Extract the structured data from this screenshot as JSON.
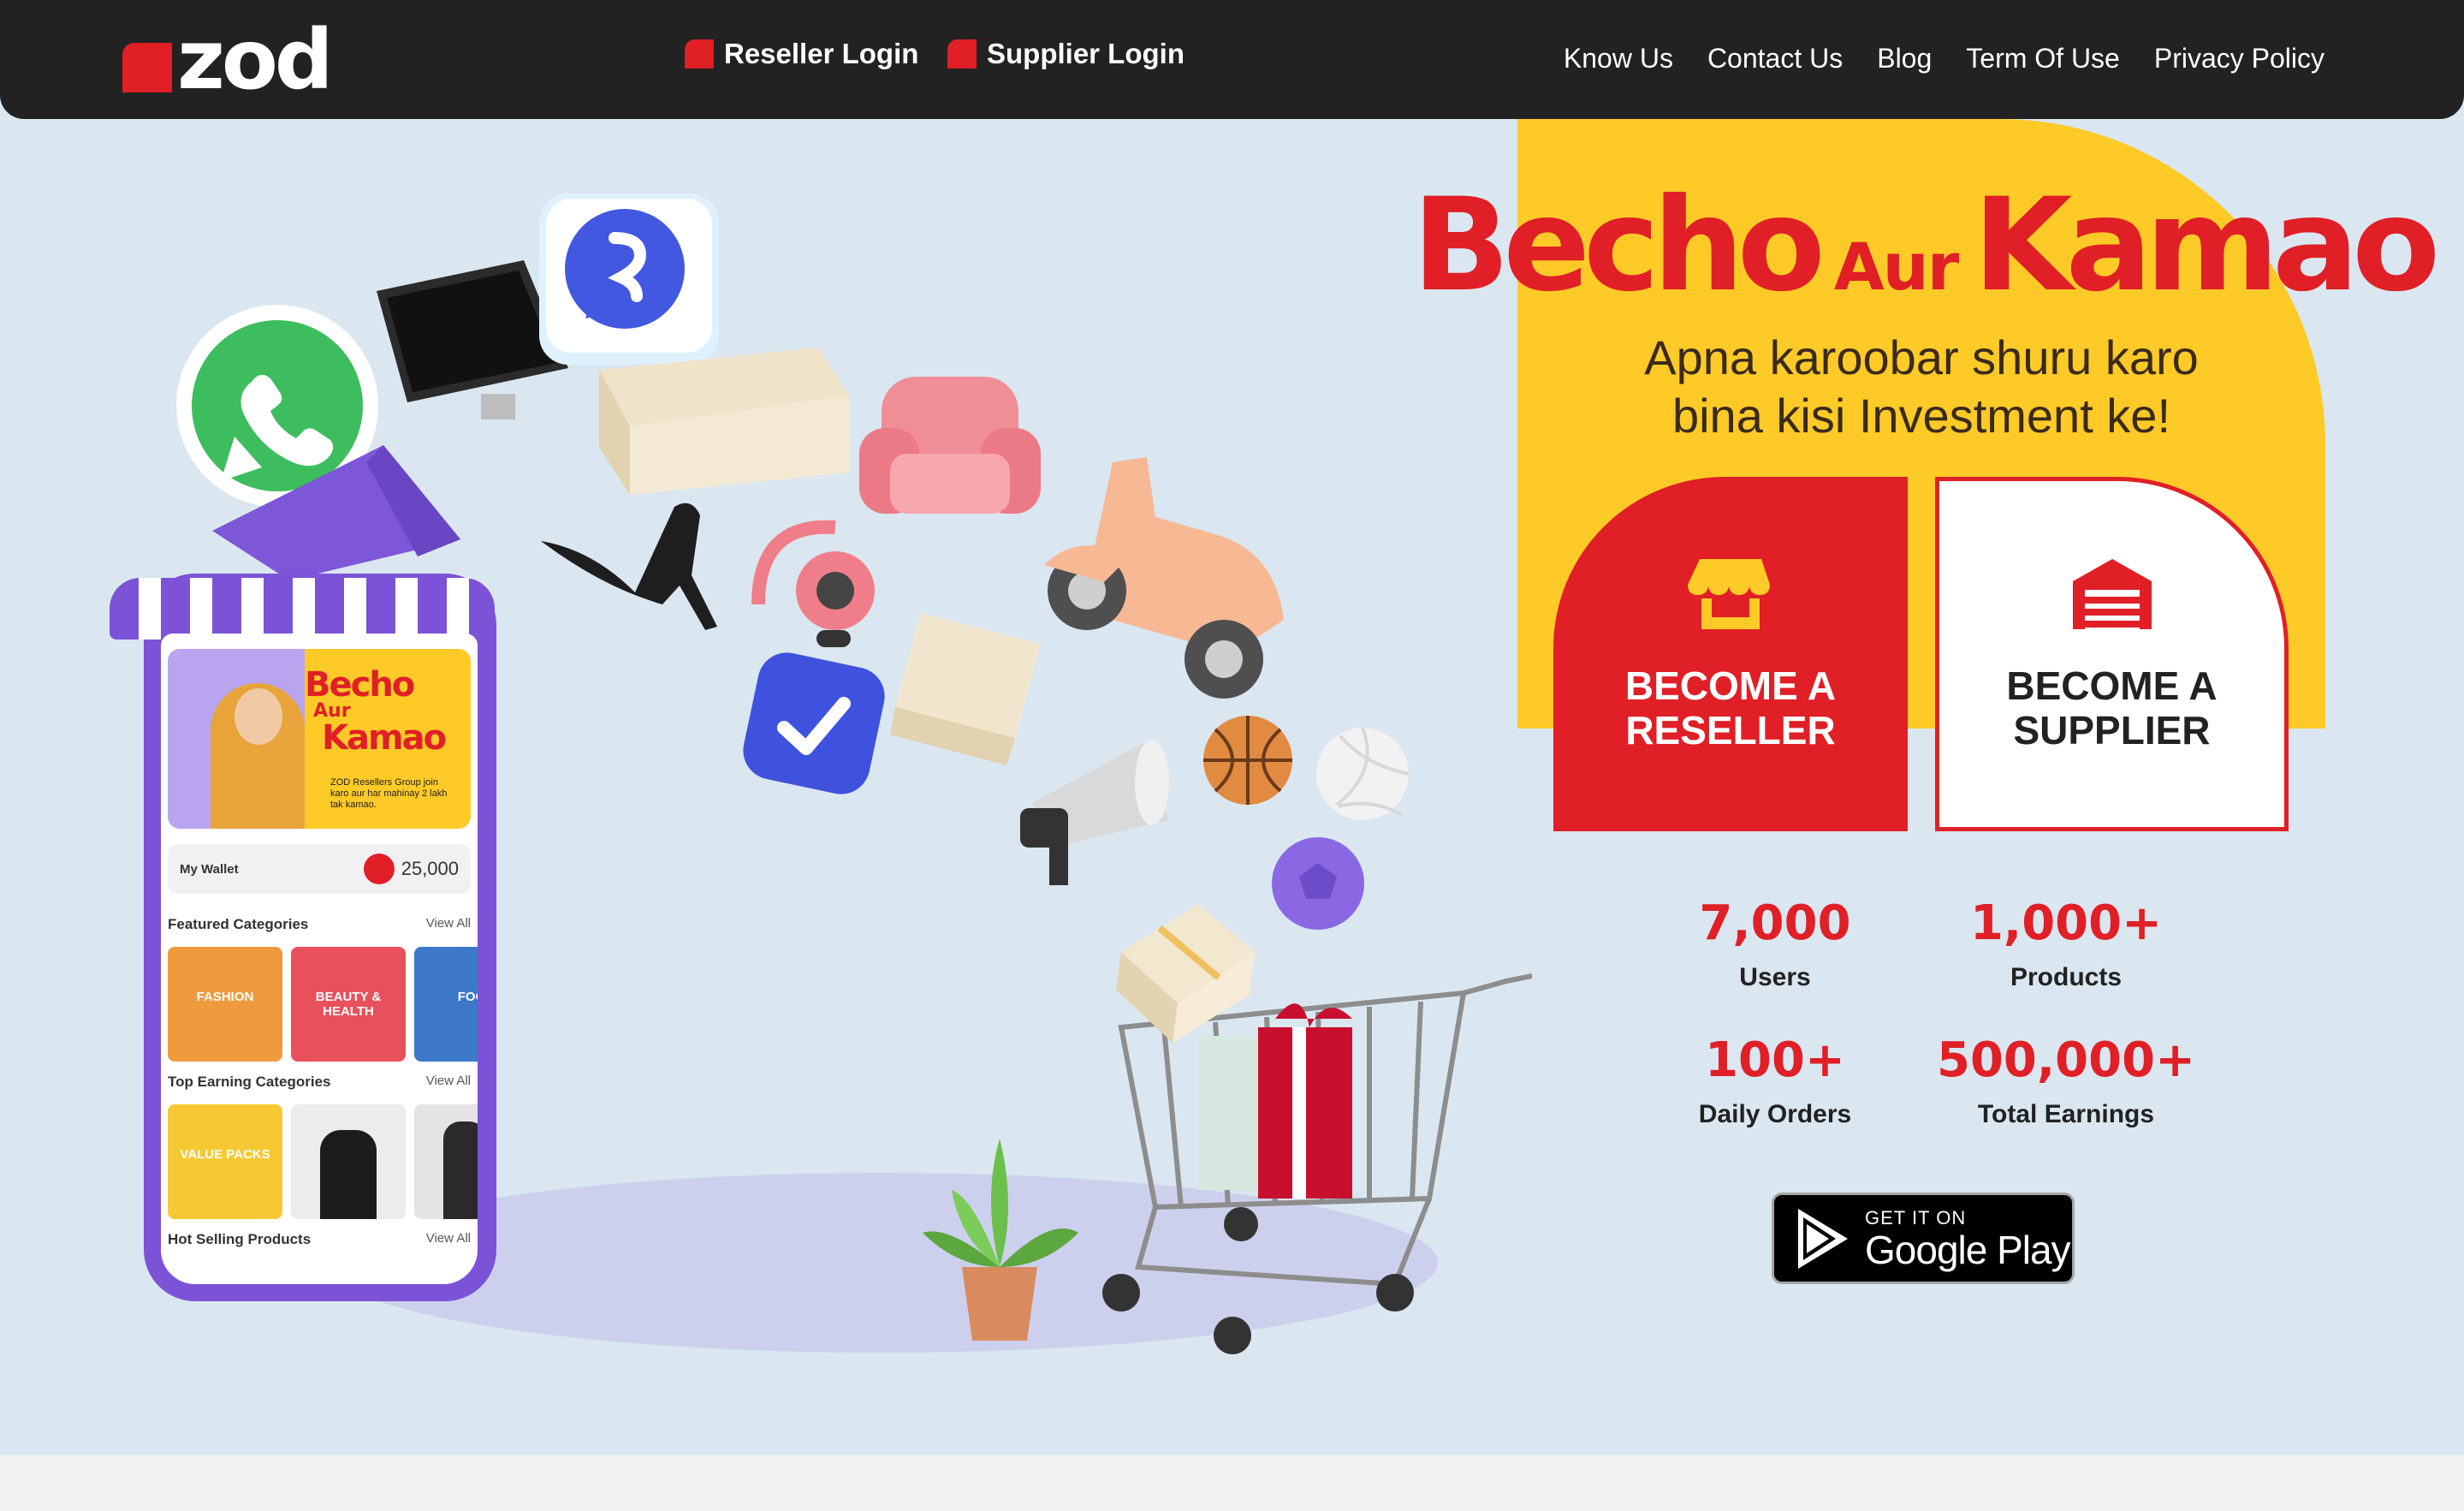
{
  "nav": {
    "logo": "zod",
    "reseller_login": "Reseller Login",
    "supplier_login": "Supplier Login",
    "links": [
      "Know Us",
      "Contact Us",
      "Blog",
      "Term Of Use",
      "Privacy Policy"
    ]
  },
  "hero": {
    "headline_part1": "Becho",
    "headline_part2": "Aur",
    "headline_part3": "Kamao",
    "subline_1": "Apna karoobar shuru karo",
    "subline_2": "bina kisi Investment ke!",
    "cta_reseller": "BECOME A RESELLER",
    "cta_supplier": "BECOME A SUPPLIER"
  },
  "stats": [
    {
      "value": "7,000",
      "label": "Users"
    },
    {
      "value": "1,000+",
      "label": "Products"
    },
    {
      "value": "100+",
      "label": "Daily Orders"
    },
    {
      "value": "500,000+",
      "label": "Total Earnings"
    }
  ],
  "google_play": {
    "small": "GET IT ON",
    "big": "Google Play"
  },
  "phone": {
    "banner_title_1": "Becho",
    "banner_title_2": "Aur",
    "banner_title_3": "Kamao",
    "banner_sub": "ZOD Resellers Group join karo aur har mahinay 2 lakh tak kamao.",
    "wallet_label": "My Wallet",
    "wallet_amount": "25,000",
    "featured_title": "Featured Categories",
    "top_earning_title": "Top Earning Categories",
    "hot_selling_title": "Hot Selling Products",
    "view_all": "View All",
    "featured_tiles": [
      "FASHION",
      "BEAUTY & HEALTH",
      "FOO"
    ],
    "top_tiles": [
      "VALUE PACKS",
      "",
      ""
    ]
  },
  "colors": {
    "brand_red": "#e01f26",
    "brand_yellow": "#fdca27",
    "nav_bg": "#222222",
    "hero_bg": "#dae6f0",
    "phone_purple": "#7c53d6"
  }
}
